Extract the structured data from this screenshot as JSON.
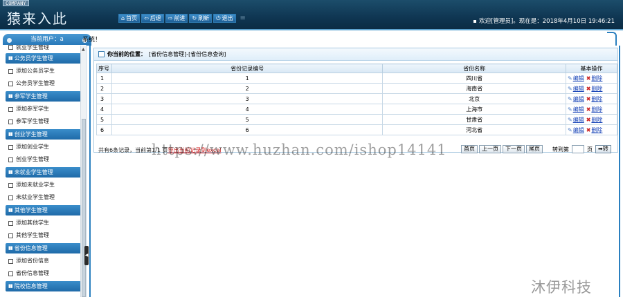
{
  "header": {
    "company_tag": "COMPANY",
    "logo": "猿来入此",
    "nav": [
      {
        "icon": "home-icon",
        "glyph": "⌂",
        "label": "首页"
      },
      {
        "icon": "back-icon",
        "glyph": "⇦",
        "label": "后退"
      },
      {
        "icon": "forward-icon",
        "glyph": "⇨",
        "label": "前进"
      },
      {
        "icon": "refresh-icon",
        "glyph": "↻",
        "label": "刷新"
      },
      {
        "icon": "power-icon",
        "glyph": "⏻",
        "label": "退出"
      }
    ],
    "welcome": "欢迎[管理员]。现在是：2018年4月10日 19:46:21"
  },
  "tabbar": {
    "current_user": "当前用户：a",
    "system_label": "系统！"
  },
  "sidebar": {
    "top_item": "就业学生管理",
    "groups": [
      {
        "title": "公务员学生管理",
        "items": [
          "添加公务员学生",
          "公务员学生管理"
        ]
      },
      {
        "title": "参军学生管理",
        "items": [
          "添加参军学生",
          "参军学生管理"
        ]
      },
      {
        "title": "创业学生管理",
        "items": [
          "添加创业学生",
          "创业学生管理"
        ]
      },
      {
        "title": "未就业学生管理",
        "items": [
          "添加未就业学生",
          "未就业学生管理"
        ]
      },
      {
        "title": "其他学生管理",
        "items": [
          "添加其他学生",
          "其他学生管理"
        ]
      },
      {
        "title": "省份信息管理",
        "items": [
          "添加省份信息",
          "省份信息管理"
        ]
      },
      {
        "title": "院校信息管理",
        "items": []
      }
    ]
  },
  "location": {
    "label": "你当前的位置：",
    "path": "[省份信息管理]-[省份信息查询]"
  },
  "table": {
    "headers": [
      "序号",
      "省份记录编号",
      "省份名称",
      "基本操作"
    ],
    "rows": [
      {
        "idx": "1",
        "code": "1",
        "name": "四川省"
      },
      {
        "idx": "2",
        "code": "2",
        "name": "海南省"
      },
      {
        "idx": "3",
        "code": "3",
        "name": "北京"
      },
      {
        "idx": "4",
        "code": "4",
        "name": "上海市"
      },
      {
        "idx": "5",
        "code": "5",
        "name": "甘肃省"
      },
      {
        "idx": "6",
        "code": "6",
        "name": "河北省"
      }
    ],
    "edit_label": "编辑",
    "delete_label": "删除"
  },
  "pager": {
    "info": "共有6条记录，当前第1/1 页",
    "export": "导出当前记录到excel",
    "first": "首页",
    "prev": "上一页",
    "next": "下一页",
    "last": "尾页",
    "goto_label": "转到第",
    "page_label": "页",
    "go": "➡转"
  },
  "watermark": "https://www.huzhan.com/ishop14141",
  "brand_mark": "沐伊科技"
}
